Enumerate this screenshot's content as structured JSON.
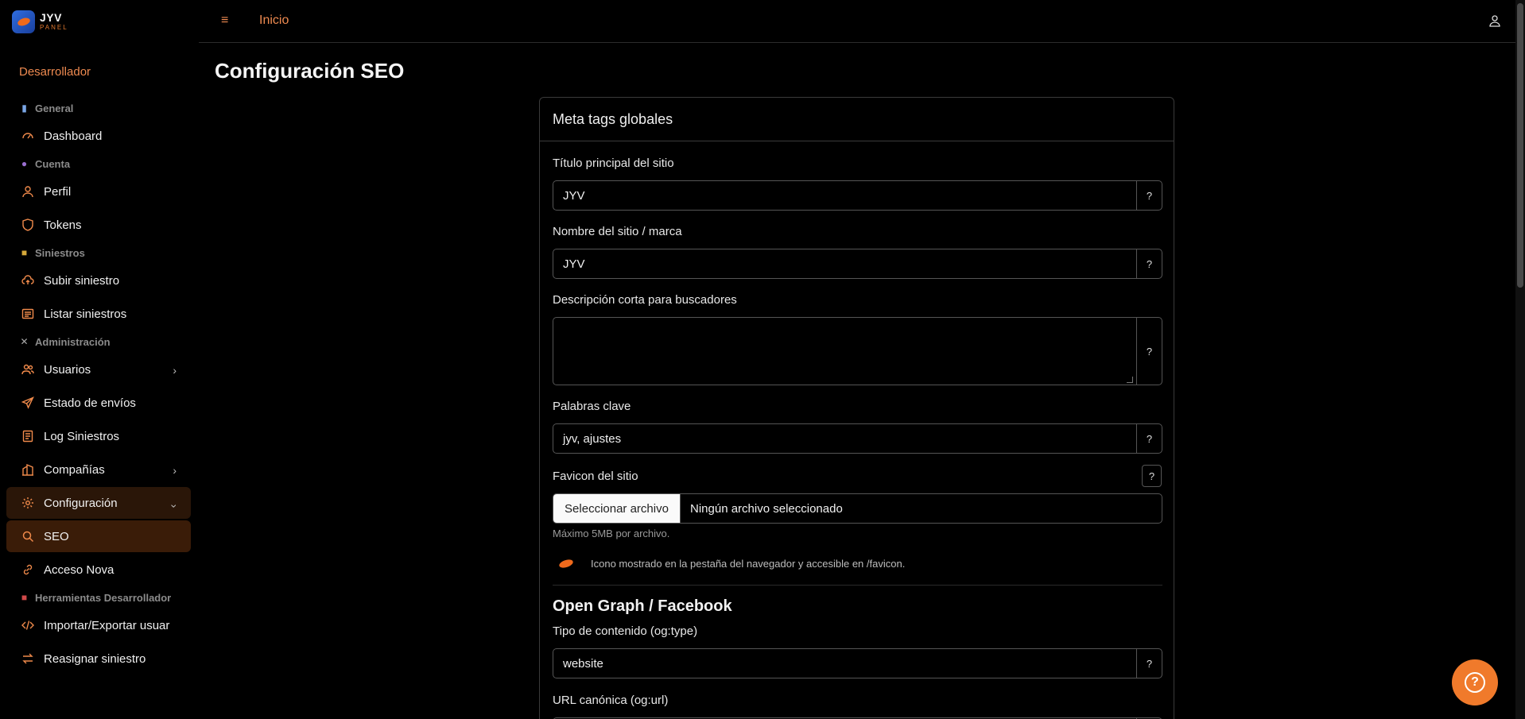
{
  "brand": {
    "name": "JYV",
    "sub": "PANEL"
  },
  "sidebar": {
    "role": "Desarrollador",
    "sections": [
      {
        "title": "General",
        "icon": "chart-icon",
        "items": [
          {
            "label": "Dashboard",
            "icon": "gauge-icon"
          }
        ]
      },
      {
        "title": "Cuenta",
        "icon": "user-icon",
        "items": [
          {
            "label": "Perfil",
            "icon": "user-icon"
          },
          {
            "label": "Tokens",
            "icon": "shield-icon"
          }
        ]
      },
      {
        "title": "Siniestros",
        "icon": "folder-icon",
        "items": [
          {
            "label": "Subir siniestro",
            "icon": "cloud-upload-icon"
          },
          {
            "label": "Listar siniestros",
            "icon": "list-icon"
          }
        ]
      },
      {
        "title": "Administración",
        "icon": "tools-icon",
        "items": [
          {
            "label": "Usuarios",
            "icon": "users-icon"
          },
          {
            "label": "Estado de envíos",
            "icon": "send-icon"
          },
          {
            "label": "Log Siniestros",
            "icon": "log-icon"
          },
          {
            "label": "Compañías",
            "icon": "building-icon"
          },
          {
            "label": "Configuración",
            "icon": "gear-icon"
          },
          {
            "label": "SEO",
            "icon": "search-icon"
          },
          {
            "label": "Acceso Nova",
            "icon": "link-icon"
          }
        ]
      },
      {
        "title": "Herramientas Desarrollador",
        "icon": "toolbox-icon",
        "items": [
          {
            "label": "Importar/Exportar usuar",
            "icon": "code-icon"
          },
          {
            "label": "Reasignar siniestro",
            "icon": "swap-icon"
          }
        ]
      }
    ]
  },
  "topbar": {
    "menu_icon": "≡",
    "home": "Inicio"
  },
  "page": {
    "title": "Configuración SEO"
  },
  "card": {
    "header": "Meta tags globales",
    "fields": {
      "title": {
        "label": "Título principal del sitio",
        "value": "JYV"
      },
      "site_name": {
        "label": "Nombre del sitio / marca",
        "value": "JYV"
      },
      "description": {
        "label": "Descripción corta para buscadores",
        "value": ""
      },
      "keywords": {
        "label": "Palabras clave",
        "value": "jyv, ajustes"
      },
      "favicon": {
        "label": "Favicon del sitio",
        "button": "Seleccionar archivo",
        "file": "Ningún archivo seleccionado",
        "hint": "Máximo 5MB por archivo.",
        "desc": "Icono mostrado en la pestaña del navegador y accesible en /favicon."
      },
      "og_type": {
        "label": "Tipo de contenido (og:type)",
        "value": "website"
      },
      "og_url": {
        "label": "URL canónica (og:url)"
      }
    },
    "og_heading": "Open Graph / Facebook",
    "help": "?"
  },
  "colors": {
    "accent": "#f07a2b",
    "background": "#000000",
    "active_item": "#3a1c08"
  }
}
